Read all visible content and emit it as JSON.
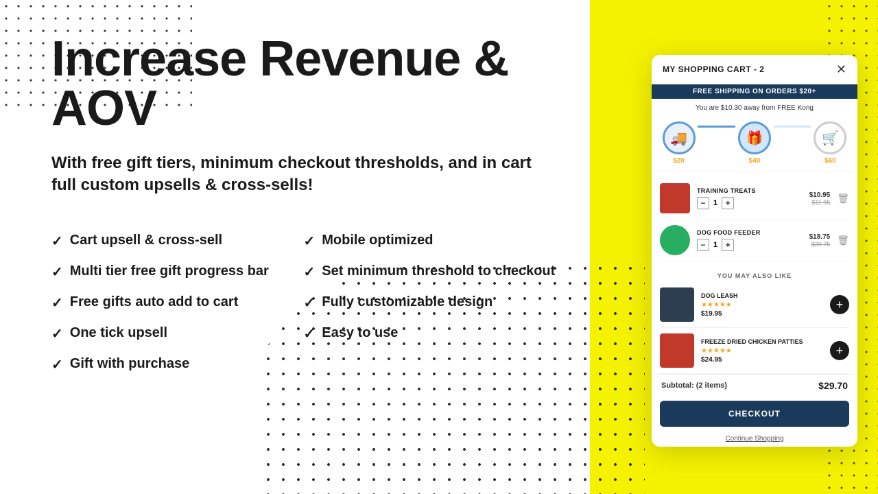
{
  "page": {
    "title": "Increase Revenue & AOV",
    "subtitle": "With free gift tiers, minimum checkout thresholds, and in cart full custom upsells & cross-sells!",
    "features_left": [
      "Cart upsell & cross-sell",
      "Multi tier free gift progress bar",
      "Free gifts auto add to cart",
      "One tick upsell",
      "Gift with purchase"
    ],
    "features_right": [
      "Mobile optimized",
      "Set minimum threshold to checkout",
      "Fully customizable design",
      "Easy to use"
    ]
  },
  "cart": {
    "header_title": "MY SHOPPING CART - 2",
    "close_label": "✕",
    "free_shipping_banner": "FREE SHIPPING ON ORDERS $20+",
    "free_kong_message": "You are $10.30 away from FREE Kong",
    "tiers": [
      {
        "label": "$20",
        "icon": "🚚",
        "state": "active"
      },
      {
        "label": "$40",
        "icon": "🎁",
        "state": "current"
      },
      {
        "label": "$60",
        "icon": "🛒",
        "state": "inactive"
      }
    ],
    "items": [
      {
        "name": "TRAINING TREATS",
        "qty": 1,
        "price_new": "$10.95",
        "price_old": "$11.95",
        "color": "#c0392b"
      },
      {
        "name": "DOG FOOD FEEDER",
        "qty": 1,
        "price_new": "$18.75",
        "price_old": "$20.75",
        "color": "#2980b9"
      }
    ],
    "also_like_header": "YOU MAY ALSO LIKE",
    "also_like_items": [
      {
        "name": "DOG LEASH",
        "stars": "★★★★★",
        "price": "$19.95",
        "color": "#2c3e50"
      },
      {
        "name": "FREEZE DRIED CHICKEN PATTIES",
        "stars": "★★★★★",
        "price": "$24.95",
        "color": "#c0392b"
      }
    ],
    "subtotal_label": "Subtotal: (2 items)",
    "subtotal_value": "$29.70",
    "checkout_label": "CHECKOUT",
    "continue_label": "Continue Shopping"
  }
}
